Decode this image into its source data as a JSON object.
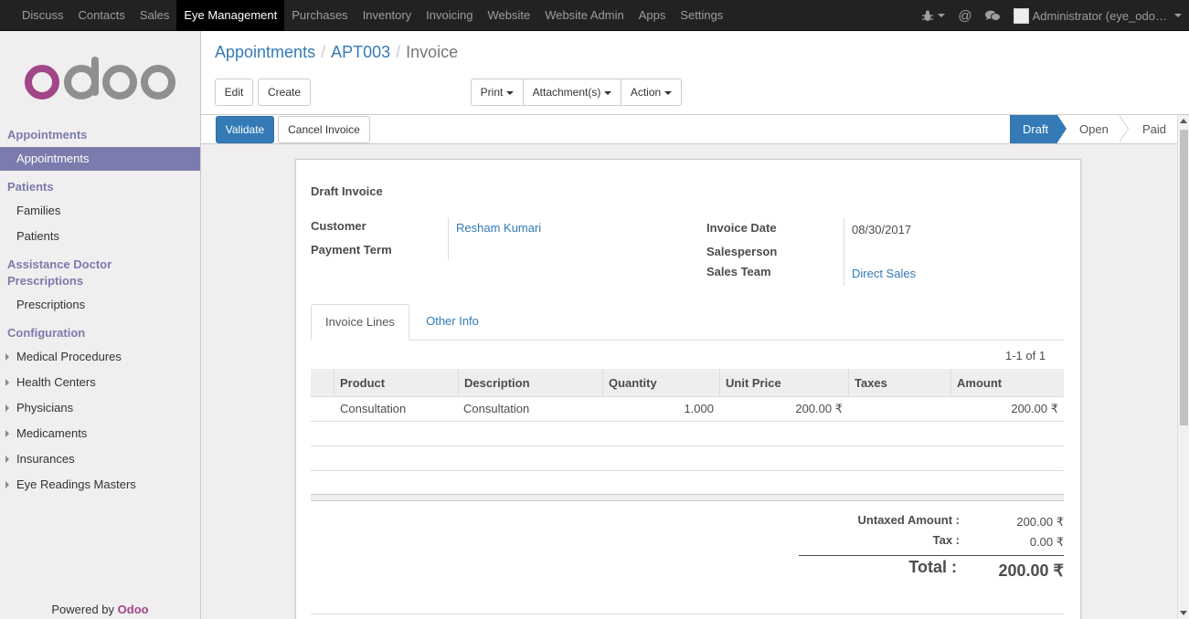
{
  "topbar": {
    "menu": [
      "Discuss",
      "Contacts",
      "Sales",
      "Eye Management",
      "Purchases",
      "Inventory",
      "Invoicing",
      "Website",
      "Website Admin",
      "Apps",
      "Settings"
    ],
    "active": "Eye Management",
    "user": "Administrator (eye_odo…"
  },
  "sidebar": {
    "logo": "odoo",
    "sections": [
      {
        "title": "Appointments",
        "items": [
          {
            "label": "Appointments",
            "active": true
          }
        ]
      },
      {
        "title": "Patients",
        "items": [
          {
            "label": "Families"
          },
          {
            "label": "Patients"
          }
        ]
      },
      {
        "title": "Assistance Doctor Prescriptions",
        "items": [
          {
            "label": "Prescriptions"
          }
        ]
      },
      {
        "title": "Configuration",
        "items": [
          {
            "label": "Medical Procedures"
          },
          {
            "label": "Health Centers"
          },
          {
            "label": "Physicians"
          },
          {
            "label": "Medicaments"
          },
          {
            "label": "Insurances"
          },
          {
            "label": "Eye Readings Masters"
          }
        ]
      }
    ],
    "powered_prefix": "Powered by ",
    "powered_brand": "Odoo"
  },
  "breadcrumb": {
    "root": "Appointments",
    "record": "APT003",
    "current": "Invoice"
  },
  "buttons": {
    "edit": "Edit",
    "create": "Create",
    "print": "Print",
    "attachments": "Attachment(s)",
    "action": "Action",
    "validate": "Validate",
    "cancel_invoice": "Cancel Invoice"
  },
  "stages": [
    {
      "label": "Draft",
      "active": true
    },
    {
      "label": "Open",
      "active": false
    },
    {
      "label": "Paid",
      "active": false
    }
  ],
  "invoice": {
    "title": "Draft Invoice",
    "customer_label": "Customer",
    "customer": "Resham Kumari",
    "payment_term_label": "Payment Term",
    "invoice_date_label": "Invoice Date",
    "invoice_date": "08/30/2017",
    "salesperson_label": "Salesperson",
    "sales_team_label": "Sales Team",
    "sales_team": "Direct Sales"
  },
  "tabs": [
    "Invoice Lines",
    "Other Info"
  ],
  "pager": "1-1 of 1",
  "lines": {
    "headers": [
      "Product",
      "Description",
      "Quantity",
      "Unit Price",
      "Taxes",
      "Amount"
    ],
    "rows": [
      {
        "product": "Consultation",
        "description": "Consultation",
        "quantity": "1.000",
        "unit_price": "200.00 ₹",
        "taxes": "",
        "amount": "200.00 ₹"
      }
    ]
  },
  "totals": {
    "untaxed_label": "Untaxed Amount :",
    "untaxed": "200.00 ₹",
    "tax_label": "Tax :",
    "tax": "0.00 ₹",
    "total_label": "Total :",
    "total": "200.00 ₹"
  },
  "colors": {
    "brand": "#7c7bad",
    "primary": "#337ab7",
    "odoo": "#a24689"
  }
}
